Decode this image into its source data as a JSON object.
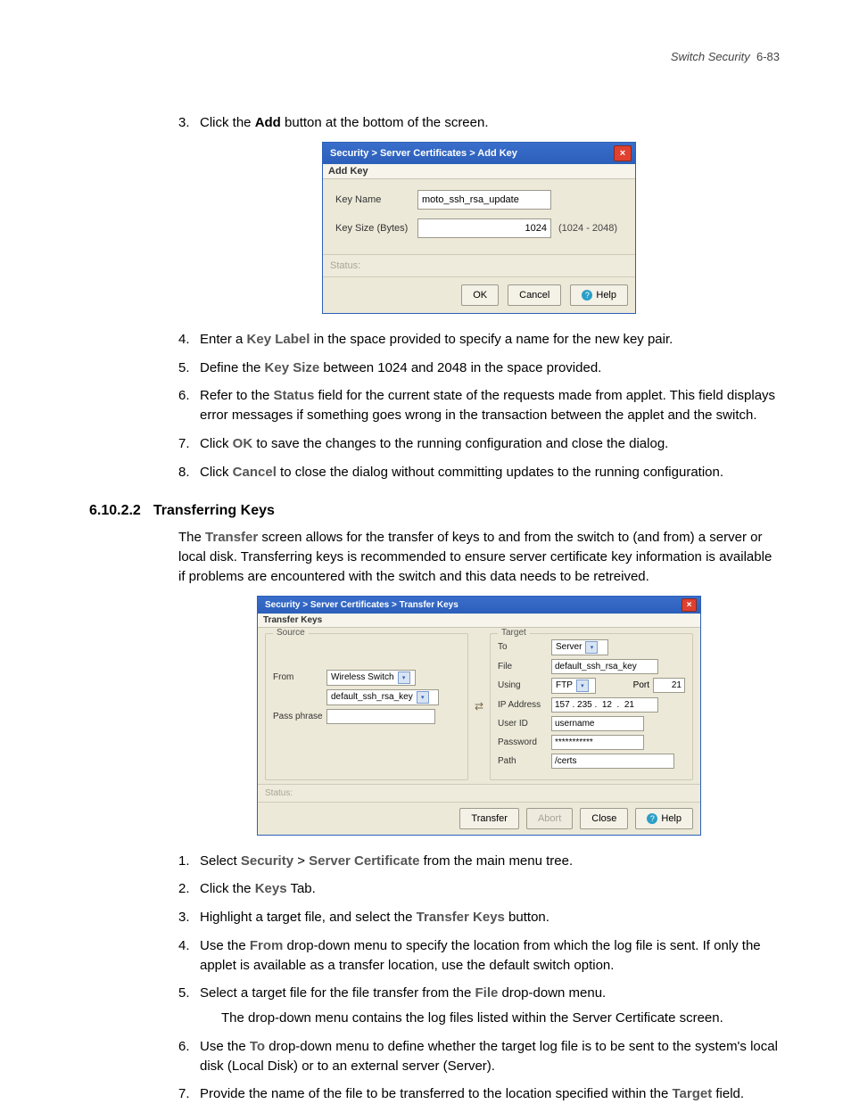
{
  "header": {
    "section": "Switch Security",
    "pagenum": "6-83"
  },
  "steps1": {
    "s3_a": "Click the ",
    "s3_b": "Add",
    "s3_c": " button at the bottom of the screen.",
    "s4_a": "Enter a ",
    "s4_b": "Key Label",
    "s4_c": " in the space provided to specify a name for the new key pair.",
    "s5_a": "Define the ",
    "s5_b": "Key Size",
    "s5_c": " between 1024 and 2048 in the space provided.",
    "s6_a": "Refer to the ",
    "s6_b": "Status",
    "s6_c": " field for the current state of the requests made from applet. This field displays error messages if something goes wrong in the transaction between the applet and the switch.",
    "s7_a": "Click ",
    "s7_b": "OK",
    "s7_c": " to save the changes to the running configuration and close the dialog.",
    "s8_a": "Click ",
    "s8_b": "Cancel",
    "s8_c": " to close the dialog without committing updates to the running configuration."
  },
  "dlg1": {
    "title": "Security > Server Certificates > Add Key",
    "sub": "Add Key",
    "keyname_lbl": "Key Name",
    "keyname_val": "moto_ssh_rsa_update",
    "keysize_lbl": "Key Size (Bytes)",
    "keysize_val": "1024",
    "keysize_hint": "(1024 - 2048)",
    "status": "Status:",
    "ok": "OK",
    "cancel": "Cancel",
    "help": "Help"
  },
  "sec": {
    "num": "6.10.2.2",
    "title": "Transferring Keys"
  },
  "para1_a": "The ",
  "para1_b": "Transfer",
  "para1_c": " screen allows for the transfer of keys to and from the switch to (and from) a server or local disk. Transferring keys is recommended to ensure server certificate key information is available if problems are encountered with the switch and this data needs to be retreived.",
  "dlg2": {
    "title": "Security > Server Certificates > Transfer Keys",
    "sub": "Transfer Keys",
    "src": "Source",
    "tgt": "Target",
    "from": "From",
    "from_sel": "Wireless Switch",
    "from_file": "default_ssh_rsa_key",
    "pass": "Pass phrase",
    "to": "To",
    "to_sel": "Server",
    "file": "File",
    "file_val": "default_ssh_rsa_key",
    "using": "Using",
    "using_sel": "FTP",
    "port": "Port",
    "port_val": "21",
    "ip": "IP Address",
    "ip_val": "157 . 235 .  12  .  21",
    "uid": "User ID",
    "uid_val": "username",
    "pwd": "Password",
    "pwd_val": "***********",
    "path": "Path",
    "path_val": "/certs",
    "status": "Status:",
    "transfer": "Transfer",
    "abort": "Abort",
    "close": "Close",
    "help": "Help"
  },
  "steps2": {
    "s1_a": "Select ",
    "s1_b": "Security",
    "s1_c": " > ",
    "s1_d": "Server Certificate",
    "s1_e": " from the main menu tree.",
    "s2_a": "Click the ",
    "s2_b": "Keys",
    "s2_c": " Tab.",
    "s3_a": "Highlight a target file, and select the ",
    "s3_b": "Transfer Keys",
    "s3_c": " button.",
    "s4_a": "Use the ",
    "s4_b": "From",
    "s4_c": " drop-down menu to specify the location from which the log file is sent. If only the applet is available as a transfer location, use the default switch option.",
    "s5_a": "Select a target file for the file transfer from the ",
    "s5_b": "File",
    "s5_c": " drop-down menu.",
    "s5_note": "The drop-down menu contains the log files listed within the Server Certificate screen.",
    "s6_a": "Use the ",
    "s6_b": "To",
    "s6_c": " drop-down menu to define whether the target log file is to be sent to the system's local disk (Local Disk) or to an external server (Server).",
    "s7_a": "Provide the name of the file to be transferred to the location specified within the ",
    "s7_b": "Target",
    "s7_c": " field."
  }
}
